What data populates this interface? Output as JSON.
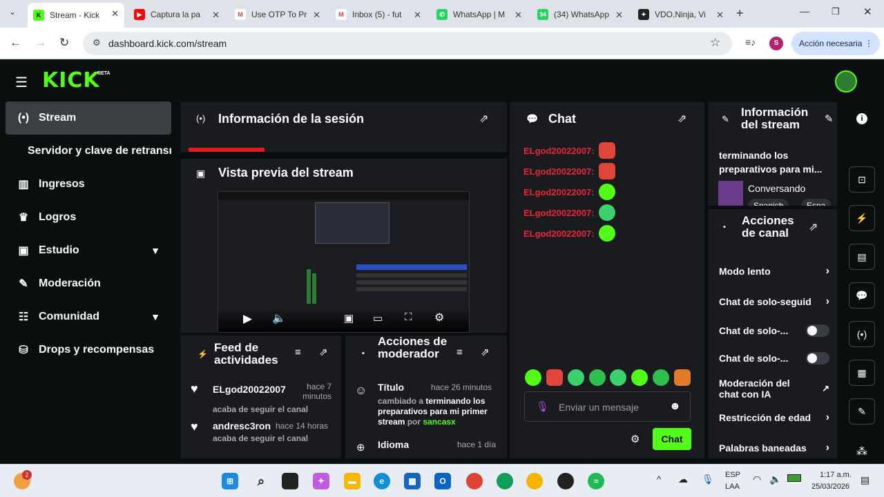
{
  "browser": {
    "tabs": [
      {
        "label": "Stream - Kick",
        "icon": "kick-icon",
        "color": "#53fc18",
        "active": true
      },
      {
        "label": "Captura la pa",
        "icon": "youtube-icon",
        "color": "#ff0000"
      },
      {
        "label": "Use OTP To Pr",
        "icon": "gmail-icon",
        "color": "#ea4335"
      },
      {
        "label": "Inbox (5) - fut",
        "icon": "gmail-icon",
        "color": "#ea4335"
      },
      {
        "label": "WhatsApp | M",
        "icon": "whatsapp-icon",
        "color": "#25d366"
      },
      {
        "label": "(34) WhatsApp",
        "icon": "whatsapp-icon",
        "color": "#25d366",
        "badge": "34"
      },
      {
        "label": "VDO.Ninja, Vi",
        "icon": "ninja-icon",
        "color": "#222222"
      }
    ],
    "url": "dashboard.kick.com/stream",
    "profile_initial": "S",
    "action_button": "Acción necesaria",
    "new_tab": "+"
  },
  "kick": {
    "logo": "KICK",
    "logo_badge": "BETA"
  },
  "sidebar": {
    "items": [
      {
        "label": "Stream",
        "icon": "stream-icon",
        "glyph": "(•)",
        "active": true
      },
      {
        "label": "Servidor y clave de retransm",
        "icon": "",
        "glyph": ""
      },
      {
        "label": "Ingresos",
        "icon": "revenue-icon",
        "glyph": "▥"
      },
      {
        "label": "Logros",
        "icon": "trophy-icon",
        "glyph": "🏆"
      },
      {
        "label": "Estudio",
        "icon": "studio-icon",
        "glyph": "▣",
        "chevron": true
      },
      {
        "label": "Moderación",
        "icon": "wrench-icon",
        "glyph": "🔧"
      },
      {
        "label": "Comunidad",
        "icon": "community-icon",
        "glyph": "👥",
        "chevron": true
      },
      {
        "label": "Drops y recompensas",
        "icon": "drops-icon",
        "glyph": "⛁"
      }
    ]
  },
  "session": {
    "title": "Información de la sesión"
  },
  "preview": {
    "title": "Vista previa del stream"
  },
  "feed": {
    "title": "Feed de actividades",
    "items": [
      {
        "user": "ELgod20022007",
        "time": "hace 7 minutos",
        "text": "acaba de seguir el canal"
      },
      {
        "user": "andresc3ron",
        "time": "hace 14 horas",
        "text": "acaba de seguir el canal"
      }
    ]
  },
  "mod_actions": {
    "title": "Acciones de moderador",
    "items": [
      {
        "label": "Título",
        "time": "hace 26 minutos",
        "pre": "cambiado a ",
        "value": "terminando los preparativos para mi primer stream",
        "by": " por ",
        "user": "sancasx"
      },
      {
        "label": "Idioma",
        "time": "hace 1 día"
      }
    ]
  },
  "chat": {
    "title": "Chat",
    "messages": [
      {
        "user": "ELgod20022007:",
        "emote_color": "#e0453a"
      },
      {
        "user": "ELgod20022007:",
        "emote_color": "#e0453a"
      },
      {
        "user": "ELgod20022007:",
        "emote_color": "#53fc18"
      },
      {
        "user": "ELgod20022007:",
        "emote_color": "#3bd16f"
      },
      {
        "user": "ELgod20022007:",
        "emote_color": "#53fc18"
      }
    ],
    "placeholder": "Enviar un mensaje",
    "send": "Chat"
  },
  "stream_info": {
    "title": "Información del stream",
    "stream_title": "terminando los preparativos para mi...",
    "category": "Conversando",
    "tags": [
      "Spanish",
      "Espa"
    ]
  },
  "channel_actions": {
    "title": "Acciones de canal",
    "items": [
      {
        "label": "Modo lento",
        "control": "chevron"
      },
      {
        "label": "Chat de solo-seguid",
        "control": "chevron"
      },
      {
        "label": "Chat de solo-...",
        "control": "toggle"
      },
      {
        "label": "Chat de solo-...",
        "control": "toggle"
      },
      {
        "label": "Moderación del chat con IA",
        "control": "external"
      },
      {
        "label": "Restricción de edad",
        "control": "chevron"
      },
      {
        "label": "Palabras baneadas",
        "control": "chevron"
      }
    ]
  },
  "taskbar": {
    "lang": "ESP",
    "lang2": "LAA",
    "time": "1:17 a.m.",
    "date": "25/03/2026",
    "weather_badge": "2"
  }
}
